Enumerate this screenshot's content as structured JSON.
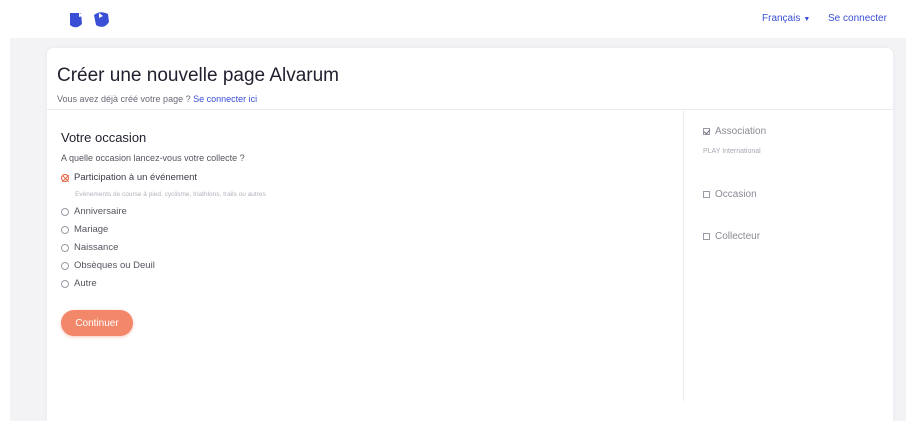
{
  "header": {
    "language": "Français",
    "login": "Se connecter"
  },
  "card": {
    "title": "Créer une nouvelle page Alvarum",
    "subtitle_text": "Vous avez déjà créé votre page ?",
    "subtitle_link": "Se connecter ici"
  },
  "form": {
    "section_title": "Votre occasion",
    "question": "A quelle occasion lancez-vous votre collecte ?",
    "selected_hint": "Evénements de course à pied, cyclisme, triathlons, trails ou autres",
    "options": [
      {
        "label": "Participation à un événement",
        "selected": true
      },
      {
        "label": "Anniversaire",
        "selected": false
      },
      {
        "label": "Mariage",
        "selected": false
      },
      {
        "label": "Naissance",
        "selected": false
      },
      {
        "label": "Obsèques ou Deuil",
        "selected": false
      },
      {
        "label": "Autre",
        "selected": false
      }
    ],
    "continue_label": "Continuer"
  },
  "steps": [
    {
      "label": "Association",
      "done": true,
      "detail": "PLAY International"
    },
    {
      "label": "Occasion",
      "done": false
    },
    {
      "label": "Collecteur",
      "done": false
    }
  ],
  "colors": {
    "accent_blue": "#3a4fd6",
    "button_orange": "#f2876a",
    "radio_selected": "#e2603f"
  },
  "icons": {
    "logo": "alvarum-logo",
    "language_caret": "chevron-down-icon",
    "step_done": "checkbox-checked-icon",
    "step_todo": "checkbox-empty-icon"
  }
}
